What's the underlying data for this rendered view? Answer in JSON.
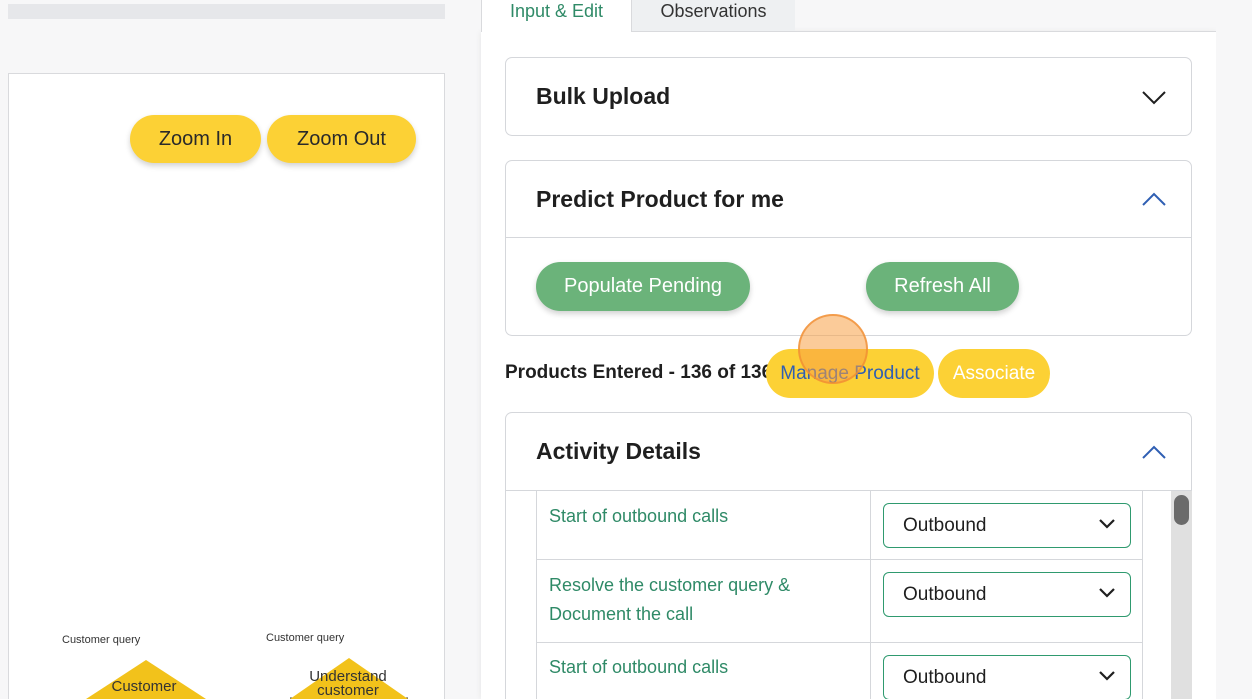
{
  "tabs": {
    "input_edit": "Input & Edit",
    "observations": "Observations"
  },
  "canvas": {
    "zoom_in": "Zoom In",
    "zoom_out": "Zoom Out",
    "flow_labels": [
      "Customer query",
      "Customer query"
    ],
    "nodes": [
      "Customer",
      "Understand\ncustomer"
    ]
  },
  "bulk_upload": {
    "title": "Bulk Upload"
  },
  "predict": {
    "title": "Predict Product for me",
    "populate": "Populate Pending",
    "refresh": "Refresh All"
  },
  "products": {
    "entered": "Products Entered - 136 of 136",
    "manage": "Manage Product",
    "associate": "Associate"
  },
  "activity": {
    "title": "Activity Details",
    "rows": [
      {
        "name": "Start of outbound calls",
        "type": "Outbound"
      },
      {
        "name": "Resolve the customer query & Document the call",
        "type": "Outbound"
      },
      {
        "name": "Start of outbound calls",
        "type": "Outbound"
      }
    ]
  },
  "colors": {
    "accent_yellow": "#fcd135",
    "accent_green": "#6bb37a",
    "link_green": "#2f8a67",
    "brand_blue": "#2f5fb3"
  },
  "icons": {
    "collapse": "chevron-down-icon",
    "expand": "chevron-up-icon",
    "select": "chevron-down-icon"
  }
}
